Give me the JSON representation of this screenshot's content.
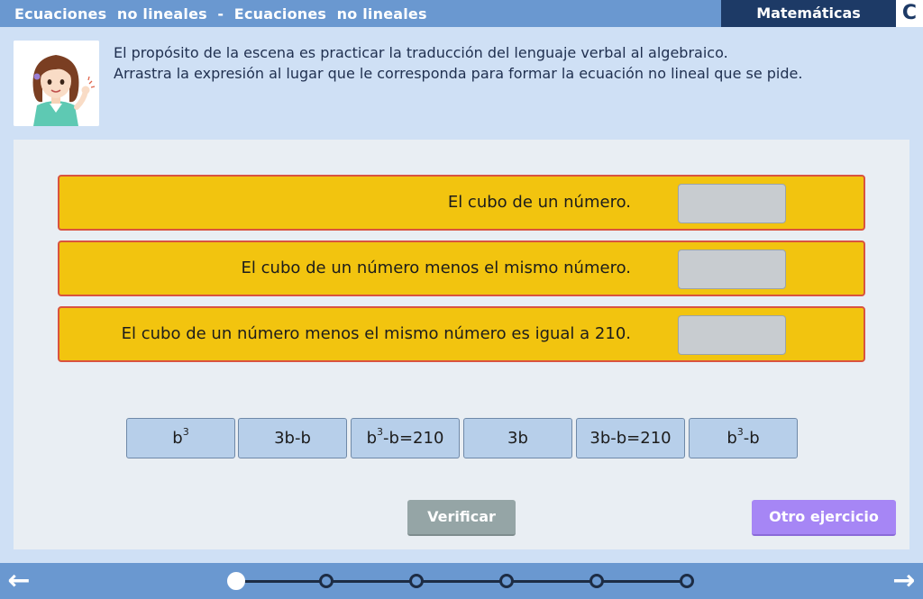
{
  "header": {
    "title": "Ecuaciones  no lineales  -  Ecuaciones  no lineales",
    "subject": "Matemáticas",
    "logo_letter": "C"
  },
  "intro": {
    "line1": "El propósito de la escena es practicar la traducción del lenguaje verbal al algebraico.",
    "line2": "Arrastra la expresión al lugar que le corresponda para formar la ecuación no lineal que se pide."
  },
  "questions": [
    {
      "text": "El cubo de un número."
    },
    {
      "text": "El cubo de un número menos el mismo número."
    },
    {
      "text": "El cubo de un número menos el mismo número es igual a 210."
    }
  ],
  "options": [
    {
      "base": "b",
      "sup": "3",
      "rest": ""
    },
    {
      "base": "3b-b",
      "sup": "",
      "rest": ""
    },
    {
      "base": "b",
      "sup": "3",
      "rest": "-b=210"
    },
    {
      "base": "3b",
      "sup": "",
      "rest": ""
    },
    {
      "base": "3b-b=210",
      "sup": "",
      "rest": ""
    },
    {
      "base": "b",
      "sup": "3",
      "rest": "-b"
    }
  ],
  "buttons": {
    "verify": "Verificar",
    "other": "Otro ejercicio"
  },
  "nav": {
    "prev_icon": "arrow-left-icon",
    "next_icon": "arrow-right-icon",
    "steps": 6,
    "current_step": 1
  },
  "colors": {
    "top_bar": "#6a98d0",
    "subject_bg": "#1d3a66",
    "question_bg": "#f2c40f",
    "question_border": "#d9533f",
    "option_bg": "#b7cfea",
    "verify_bg": "#95a5a6",
    "other_bg": "#a686f5"
  }
}
